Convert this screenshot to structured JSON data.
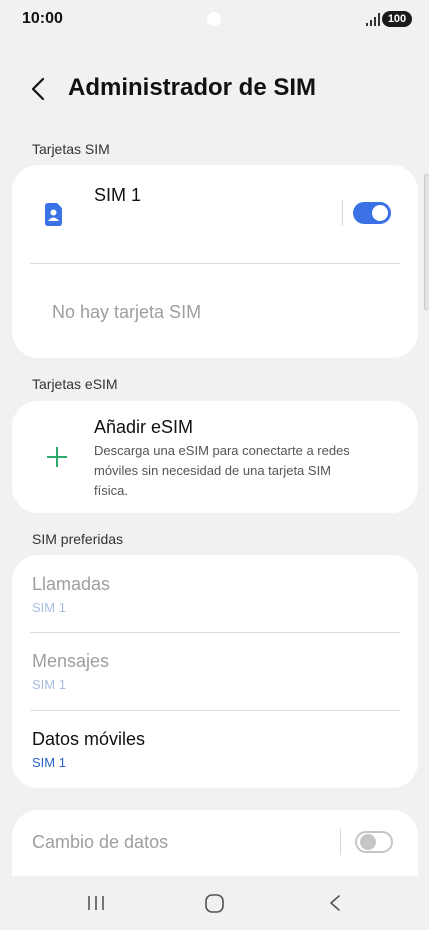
{
  "status": {
    "time": "10:00",
    "battery": "100",
    "icons": [
      "signal-icon",
      "battery-icon"
    ]
  },
  "header": {
    "title": "Administrador de SIM",
    "back_icon": "chevron-left-icon"
  },
  "sim_cards": {
    "section_label": "Tarjetas SIM",
    "sim1": {
      "name": "SIM 1",
      "icon": "sim-contact-icon",
      "enabled": true
    },
    "empty_text": "No hay tarjeta SIM"
  },
  "esim": {
    "section_label": "Tarjetas eSIM",
    "add_title": "Añadir eSIM",
    "add_description_lines": [
      "Descarga una eSIM para conectarte a redes",
      "móviles sin necesidad de una tarjeta SIM",
      "física."
    ],
    "add_icon": "plus-icon"
  },
  "preferred": {
    "section_label": "SIM preferidas",
    "items": [
      {
        "title": "Llamadas",
        "value": "SIM 1",
        "enabled": false
      },
      {
        "title": "Mensajes",
        "value": "SIM 1",
        "enabled": false
      },
      {
        "title": "Datos móviles",
        "value": "SIM 1",
        "enabled": true
      }
    ]
  },
  "data_switch": {
    "title": "Cambio de datos",
    "enabled": false
  },
  "colors": {
    "accent": "#3a72e6",
    "plus_green": "#2eaa6a",
    "background": "#f1f1f3"
  },
  "nav": {
    "icons": [
      "recent-apps-icon",
      "home-icon",
      "back-icon"
    ]
  }
}
